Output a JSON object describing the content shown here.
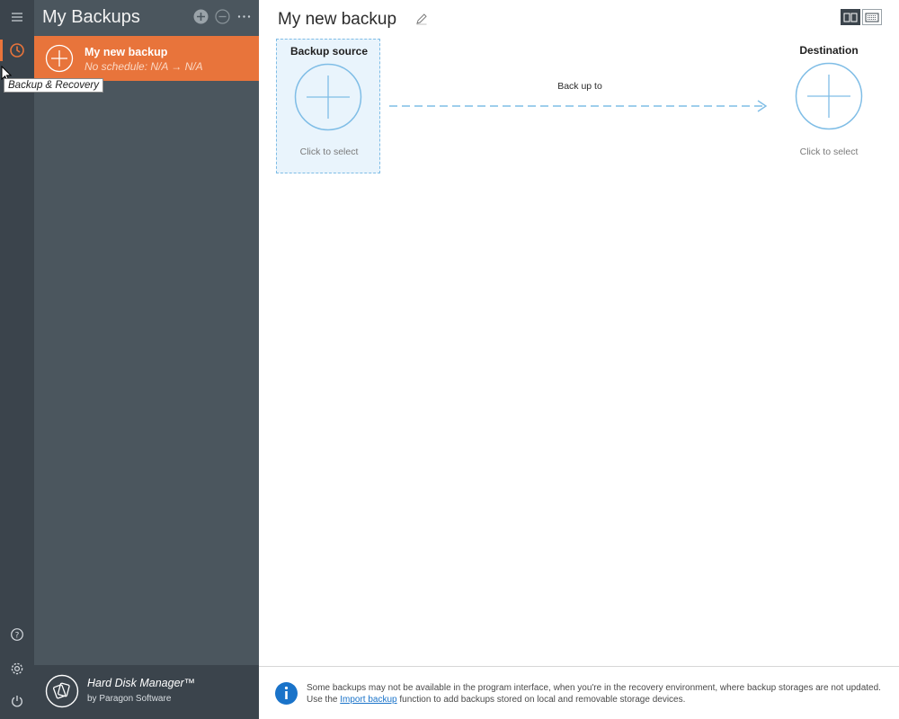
{
  "sidebar_rail": {
    "items": [
      {
        "name": "menu-icon"
      },
      {
        "name": "backup-recovery-icon",
        "active": true
      },
      {
        "name": "help-icon"
      },
      {
        "name": "settings-icon"
      },
      {
        "name": "power-icon"
      }
    ],
    "tooltip": "Backup & Recovery"
  },
  "panel": {
    "title": "My Backups",
    "backups": [
      {
        "name": "My new backup",
        "schedule": "No schedule: N/A → N/A"
      }
    ],
    "footer": {
      "product": "Hard Disk Manager™",
      "vendor": "by Paragon Software"
    }
  },
  "main": {
    "title": "My new backup",
    "source": {
      "label": "Backup source",
      "hint": "Click to select"
    },
    "arrow_label": "Back up to",
    "destination": {
      "label": "Destination",
      "hint": "Click to select"
    }
  },
  "info": {
    "line1": "Some backups may not be available in the program interface, when you're in the recovery environment, where backup storages are not updated.",
    "line2_prefix": "Use the ",
    "link": "Import backup",
    "line2_suffix": " function to add backups stored on local and removable storage devices."
  },
  "colors": {
    "accent": "#e8743b",
    "rail": "#3b444c",
    "panel": "#4b565e",
    "source_bg": "#e9f4fc",
    "line_blue": "#7fbde6"
  }
}
